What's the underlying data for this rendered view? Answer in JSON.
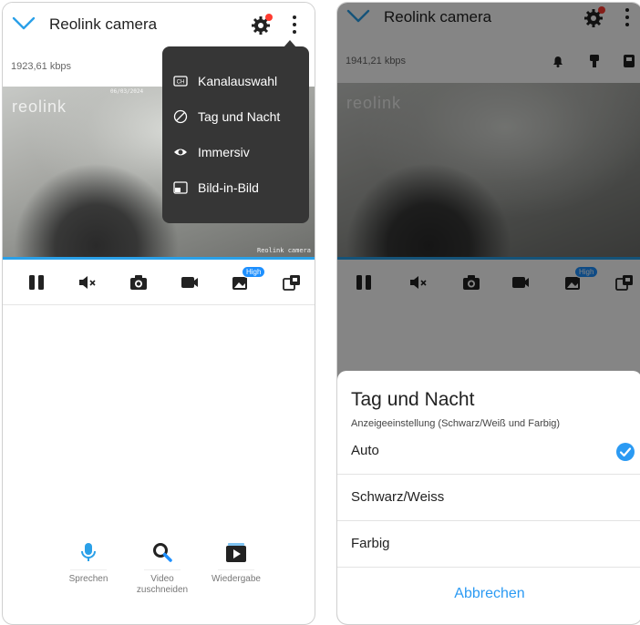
{
  "left": {
    "header": {
      "title": "Reolink camera"
    },
    "bitrate": "1923,61 kbps",
    "video": {
      "logo": "reolink",
      "timestamp": "06/03/2024",
      "camera_label": "Reolink camera"
    },
    "menu": {
      "items": [
        {
          "label": "Kanalauswahl",
          "icon": "channel-icon"
        },
        {
          "label": "Tag und Nacht",
          "icon": "day-night-icon"
        },
        {
          "label": "Immersiv",
          "icon": "eye-icon"
        },
        {
          "label": "Bild-in-Bild",
          "icon": "picture-in-picture-icon"
        }
      ]
    },
    "toolbar": {
      "quality_badge": "High"
    },
    "actions": [
      {
        "label": "Sprechen",
        "icon": "microphone-icon"
      },
      {
        "label": "Video\nzuschneiden",
        "line1": "Video",
        "line2": "zuschneiden",
        "icon": "search-icon"
      },
      {
        "label": "Wiedergabe",
        "icon": "playback-icon"
      }
    ]
  },
  "right": {
    "header": {
      "title": "Reolink camera"
    },
    "bitrate": "1941,21 kbps",
    "video": {
      "logo": "reolink"
    },
    "toolbar": {
      "quality_badge": "High"
    },
    "sheet": {
      "title": "Tag und Nacht",
      "subtitle": "Anzeigeeinstellung (Schwarz/Weiß und Farbig)",
      "options": [
        {
          "label": "Auto",
          "selected": true
        },
        {
          "label": "Schwarz/Weiss",
          "selected": false
        },
        {
          "label": "Farbig",
          "selected": false
        }
      ],
      "cancel": "Abbrechen"
    }
  },
  "colors": {
    "accent": "#2b9af3",
    "menu_bg": "#363636",
    "notification": "#ff3b30"
  }
}
